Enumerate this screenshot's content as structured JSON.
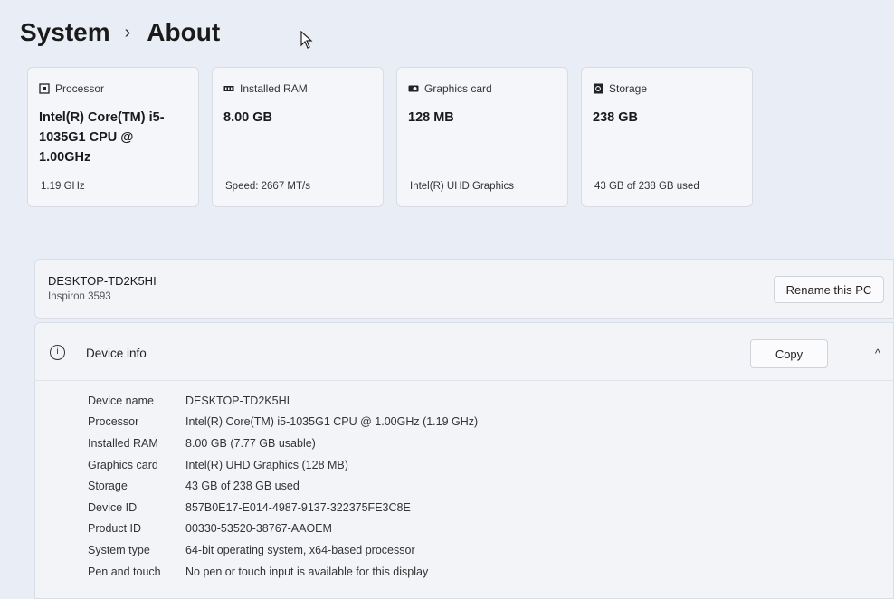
{
  "breadcrumb": {
    "parent": "System",
    "separator": "›",
    "current": "About"
  },
  "cards": [
    {
      "id": "processor",
      "icon": "processor-icon",
      "label": "Processor",
      "value": "Intel(R) Core(TM) i5-1035G1 CPU @ 1.00GHz",
      "sub": "1.19 GHz"
    },
    {
      "id": "ram",
      "icon": "ram-icon",
      "label": "Installed RAM",
      "value": "8.00 GB",
      "sub": "Speed: 2667 MT/s"
    },
    {
      "id": "graphics",
      "icon": "graphics-card-icon",
      "label": "Graphics card",
      "value": "128 MB",
      "sub": "Intel(R) UHD Graphics"
    },
    {
      "id": "storage",
      "icon": "storage-icon",
      "label": "Storage",
      "value": "238 GB",
      "sub": "43 GB of 238 GB used"
    }
  ],
  "pc": {
    "name": "DESKTOP-TD2K5HI",
    "model": "Inspiron 3593",
    "rename_label": "Rename this PC"
  },
  "device_info": {
    "title": "Device info",
    "info_glyph": "i",
    "copy_label": "Copy",
    "collapse_glyph": "^",
    "rows": [
      {
        "key": "Device name",
        "value": "DESKTOP-TD2K5HI"
      },
      {
        "key": "Processor",
        "value": "Intel(R) Core(TM) i5-1035G1 CPU @ 1.00GHz (1.19 GHz)"
      },
      {
        "key": "Installed RAM",
        "value": "8.00 GB (7.77 GB usable)"
      },
      {
        "key": "Graphics card",
        "value": "Intel(R) UHD Graphics (128 MB)"
      },
      {
        "key": "Storage",
        "value": "43 GB of 238 GB used"
      },
      {
        "key": "Device ID",
        "value": "857B0E17-E014-4987-9137-322375FE3C8E"
      },
      {
        "key": "Product ID",
        "value": "00330-53520-38767-AAOEM"
      },
      {
        "key": "System type",
        "value": "64-bit operating system, x64-based processor"
      },
      {
        "key": "Pen and touch",
        "value": "No pen or touch input is available for this display"
      }
    ]
  }
}
